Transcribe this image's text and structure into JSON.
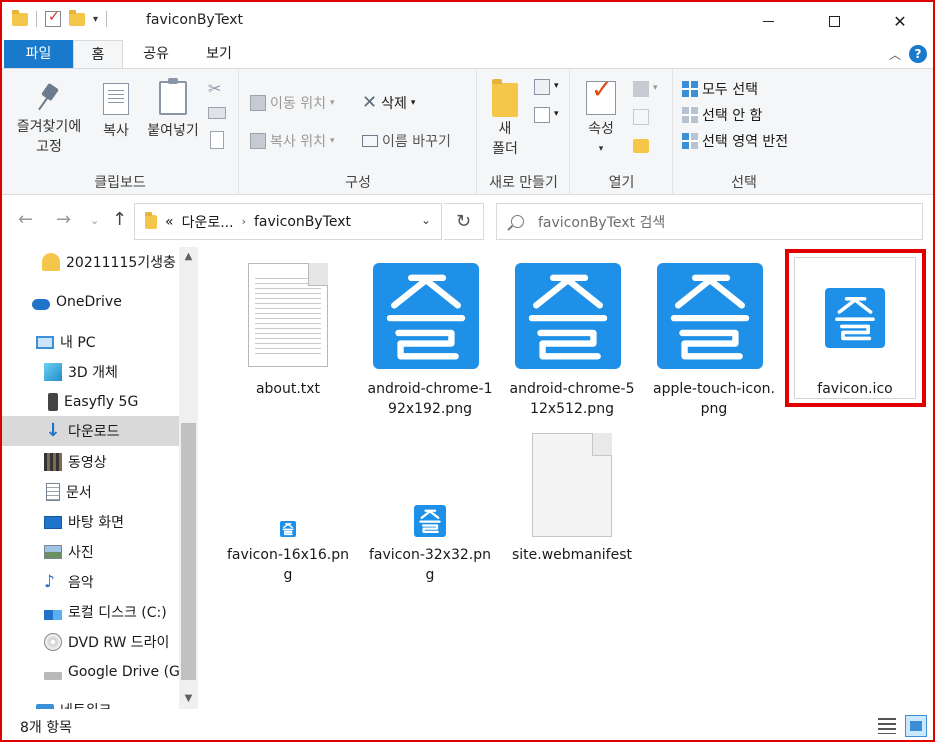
{
  "window": {
    "title": "faviconByText",
    "controls": {
      "minimize": "minimize-icon",
      "maximize": "maximize-icon",
      "close": "✕"
    }
  },
  "ribbon_tabs": {
    "file": "파일",
    "home": "홈",
    "share": "공유",
    "view": "보기",
    "help": "?"
  },
  "ribbon": {
    "clipboard": {
      "label": "클립보드",
      "pin_line1": "즐겨찾기에",
      "pin_line2": "고정",
      "copy": "복사",
      "paste": "붙여넣기"
    },
    "organize": {
      "label": "구성",
      "move_to": "이동 위치",
      "copy_to": "복사 위치",
      "delete": "삭제",
      "rename": "이름 바꾸기"
    },
    "new": {
      "label": "새로 만들기",
      "new_folder_line1": "새",
      "new_folder_line2": "폴더"
    },
    "open": {
      "label": "열기",
      "properties": "속성"
    },
    "select": {
      "label": "선택",
      "select_all": "모두 선택",
      "select_none": "선택 안 함",
      "invert": "선택 영역 반전"
    }
  },
  "address": {
    "prefix": "«",
    "crumb_parent": "다운로...",
    "crumb_current": "faviconByText",
    "search_placeholder": "faviconByText 검색"
  },
  "sidebar": {
    "items": [
      {
        "label": "20211115기생충",
        "icon": "user-folder-icon"
      },
      {
        "label": "OneDrive",
        "icon": "cloud-icon"
      },
      {
        "label": "내 PC",
        "icon": "computer-icon"
      },
      {
        "label": "3D 개체",
        "icon": "cube-icon"
      },
      {
        "label": "Easyfly 5G",
        "icon": "phone-icon"
      },
      {
        "label": "다운로드",
        "icon": "download-icon"
      },
      {
        "label": "동영상",
        "icon": "film-icon"
      },
      {
        "label": "문서",
        "icon": "document-icon"
      },
      {
        "label": "바탕 화면",
        "icon": "desktop-icon"
      },
      {
        "label": "사진",
        "icon": "picture-icon"
      },
      {
        "label": "음악",
        "icon": "music-icon"
      },
      {
        "label": "로컬 디스크 (C:)",
        "icon": "disk-icon"
      },
      {
        "label": "DVD RW 드라이",
        "icon": "dvd-icon"
      },
      {
        "label": "Google Drive (G",
        "icon": "drive-icon"
      },
      {
        "label": "네트워크",
        "icon": "network-icon"
      }
    ],
    "selected": "다운로드"
  },
  "files": [
    {
      "name": "about.txt",
      "type": "txt"
    },
    {
      "name": "android-chrome-192x192.png",
      "type": "favicon"
    },
    {
      "name": "android-chrome-512x512.png",
      "type": "favicon"
    },
    {
      "name": "apple-touch-icon.png",
      "type": "favicon"
    },
    {
      "name": "favicon.ico",
      "type": "favicon",
      "highlighted": true
    },
    {
      "name": "favicon-16x16.png",
      "type": "favicon"
    },
    {
      "name": "favicon-32x32.png",
      "type": "favicon"
    },
    {
      "name": "site.webmanifest",
      "type": "blank"
    }
  ],
  "favicon_glyph": "즐",
  "status": {
    "item_count": "8개 항목"
  },
  "colors": {
    "accent": "#1979ca",
    "favicon_bg": "#1e90e8",
    "highlight": "#e00000",
    "selected_nav": "#d9d9d9"
  }
}
